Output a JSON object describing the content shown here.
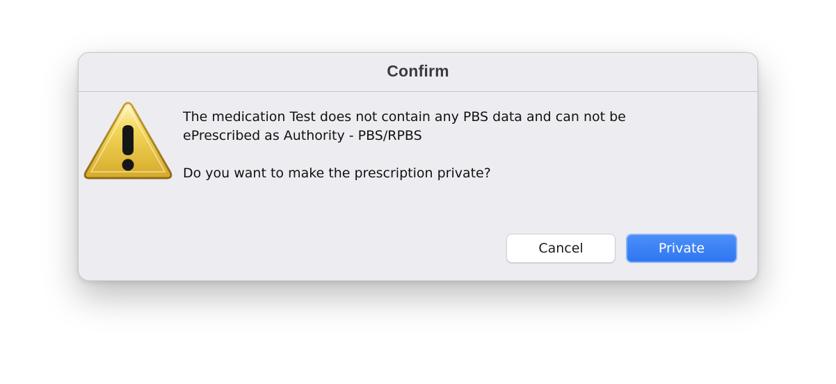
{
  "dialog": {
    "title": "Confirm",
    "message_line1": "The medication Test does not contain any PBS data and can not be",
    "message_line2": "ePrescribed as Authority - PBS/RPBS",
    "question": "Do you want to make the prescription private?",
    "icon": "warning-icon",
    "buttons": {
      "cancel_label": "Cancel",
      "private_label": "Private"
    }
  },
  "colors": {
    "dialog_background": "#edecf0",
    "primary_button": "#3580f5",
    "warning_yellow": "#e9c53a"
  }
}
